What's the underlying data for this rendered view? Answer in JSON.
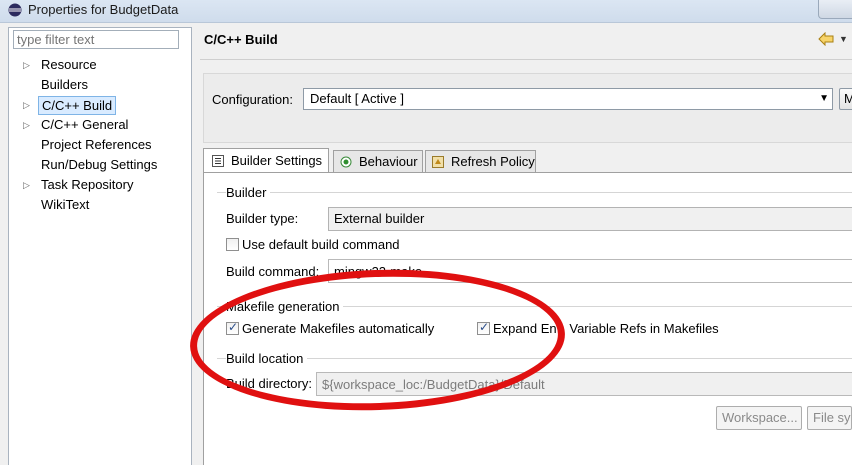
{
  "window": {
    "title": "Properties for BudgetData",
    "app_icon": "eclipse-icon"
  },
  "filter": {
    "placeholder": "type filter text"
  },
  "tree": {
    "items": [
      {
        "label": "Resource",
        "expandable": true,
        "selected": false
      },
      {
        "label": "Builders",
        "expandable": false,
        "selected": false
      },
      {
        "label": "C/C++ Build",
        "expandable": true,
        "selected": true
      },
      {
        "label": "C/C++ General",
        "expandable": true,
        "selected": false
      },
      {
        "label": "Project References",
        "expandable": false,
        "selected": false
      },
      {
        "label": "Run/Debug Settings",
        "expandable": false,
        "selected": false
      },
      {
        "label": "Task Repository",
        "expandable": true,
        "selected": false
      },
      {
        "label": "WikiText",
        "expandable": false,
        "selected": false
      }
    ]
  },
  "header": {
    "title": "C/C++ Build",
    "back_icon": "back-arrow-icon",
    "dropdown_icon": "chevron-down-icon"
  },
  "configuration": {
    "label": "Configuration:",
    "value": "Default  [ Active ]",
    "manage_label": "M"
  },
  "tabs": [
    {
      "label": "Builder Settings",
      "icon": "list-icon",
      "active": true
    },
    {
      "label": "Behaviour",
      "icon": "radio-icon",
      "active": false
    },
    {
      "label": "Refresh Policy",
      "icon": "refresh-icon",
      "active": false
    }
  ],
  "builder": {
    "group_title": "Builder",
    "type_label": "Builder type:",
    "type_value": "External builder",
    "use_default_label": "Use default build command",
    "use_default_checked": false,
    "command_label": "Build command:",
    "command_value": "mingw32-make"
  },
  "makefile": {
    "group_title": "Makefile generation",
    "generate_label": "Generate Makefiles automatically",
    "generate_checked": true,
    "expand_label": "Expand Env. Variable Refs in Makefiles",
    "expand_checked": true
  },
  "location": {
    "group_title": "Build location",
    "directory_label": "Build directory:",
    "directory_value": "${workspace_loc:/BudgetData}/Default",
    "workspace_button": "Workspace...",
    "filesystem_button": "File sys"
  },
  "annotation": {
    "color": "#e01010"
  }
}
